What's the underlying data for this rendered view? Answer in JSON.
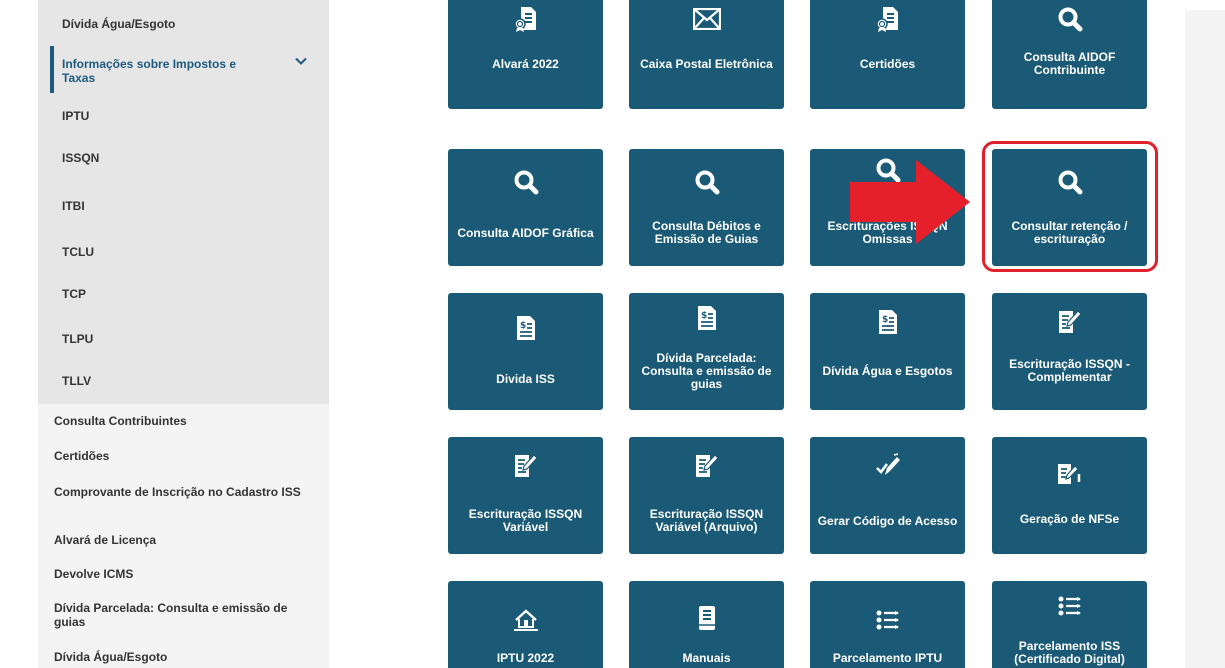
{
  "sidebar": {
    "submenu_items": [
      "Dívida Água/Esgoto",
      "IPTU",
      "ISSQN",
      "ITBI",
      "TCLU",
      "TCP",
      "TLPU",
      "TLLV"
    ],
    "active_item": "Informações sobre Impostos e Taxas",
    "main_items": [
      "Consulta Contribuintes",
      "Certidões",
      "Comprovante de Inscrição no Cadastro ISS",
      "Alvará de Licença",
      "Devolve ICMS",
      "Dívida Parcelada: Consulta e emissão de guias",
      "Dívida Água/Esgoto"
    ]
  },
  "tiles": [
    {
      "label": "Alvará 2022",
      "icon": "certificate-icon"
    },
    {
      "label": "Caixa Postal Eletrônica",
      "icon": "envelope-icon"
    },
    {
      "label": "Certidões",
      "icon": "certificate-icon"
    },
    {
      "label": "Consulta AIDOF Contribuinte",
      "icon": "search-icon"
    },
    {
      "label": "Consulta AIDOF Gráfica",
      "icon": "search-icon"
    },
    {
      "label": "Consulta Débitos e Emissão de Guias",
      "icon": "search-icon"
    },
    {
      "label": "Escriturações ISSQN Omissas",
      "icon": "search-icon"
    },
    {
      "label": "Consultar retenção / escrituração",
      "icon": "search-icon"
    },
    {
      "label": "Divida ISS",
      "icon": "invoice-icon"
    },
    {
      "label": "Dívida Parcelada: Consulta e emissão de guias",
      "icon": "invoice-icon"
    },
    {
      "label": "Dívida Água e Esgotos",
      "icon": "invoice-icon"
    },
    {
      "label": "Escrituração ISSQN - Complementar",
      "icon": "edit-document-icon"
    },
    {
      "label": "Escrituração ISSQN Variável",
      "icon": "edit-document-icon"
    },
    {
      "label": "Escrituração ISSQN Variável (Arquivo)",
      "icon": "edit-document-icon"
    },
    {
      "label": "Gerar Código de Acesso",
      "icon": "pen-check-icon"
    },
    {
      "label": "Geração de NFSe",
      "icon": "edit-document-icon"
    },
    {
      "label": "IPTU 2022",
      "icon": "house-icon"
    },
    {
      "label": "Manuais",
      "icon": "book-icon"
    },
    {
      "label": "Parcelamento IPTU",
      "icon": "list-steps-icon"
    },
    {
      "label": "Parcelamento ISS (Certificado Digital)",
      "icon": "list-steps-icon"
    }
  ],
  "colors": {
    "tile": "#1b5a76",
    "accent": "#1d5a7e",
    "highlight": "#e0202a"
  }
}
